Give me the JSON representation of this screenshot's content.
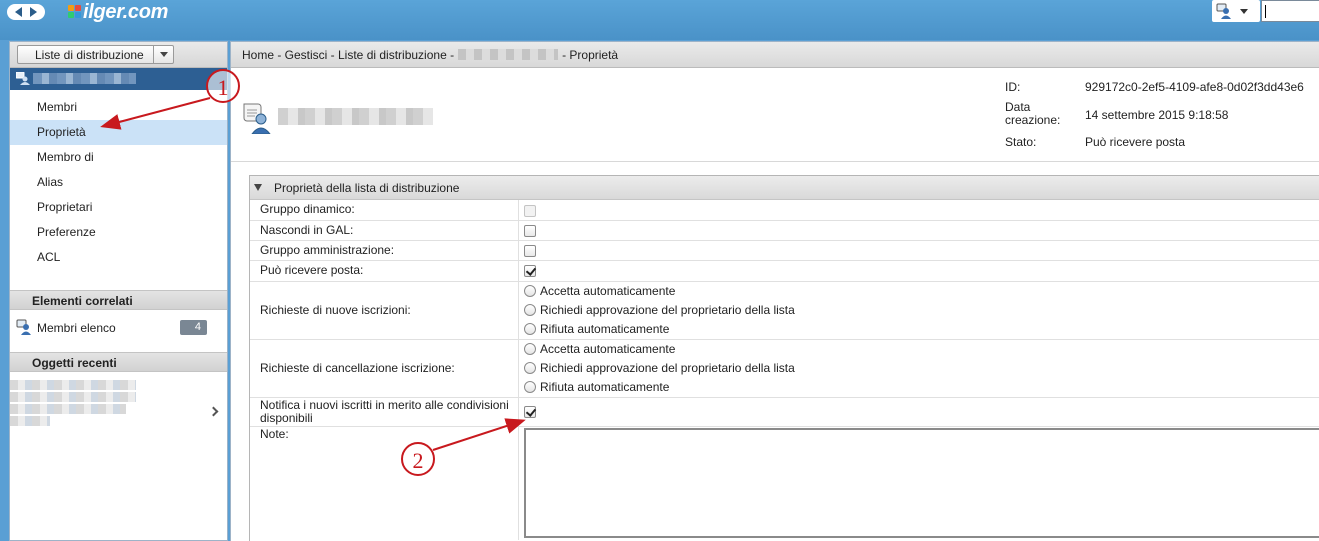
{
  "app": {
    "brand": "ilger.com"
  },
  "sidebar": {
    "back_button_label": "Liste di distribuzione",
    "nav_items": [
      {
        "label": "Membri",
        "active": false
      },
      {
        "label": "Proprietà",
        "active": true
      },
      {
        "label": "Membro di",
        "active": false
      },
      {
        "label": "Alias",
        "active": false
      },
      {
        "label": "Proprietari",
        "active": false
      },
      {
        "label": "Preferenze",
        "active": false
      },
      {
        "label": "ACL",
        "active": false
      }
    ],
    "related_section_title": "Elementi correlati",
    "related_items": [
      {
        "label": "Membri elenco",
        "count": "4"
      }
    ],
    "recent_section_title": "Oggetti recenti"
  },
  "breadcrumb": {
    "prefix": "Home - Gestisci - Liste di distribuzione -",
    "suffix": "- Proprietà"
  },
  "entity": {
    "meta": [
      {
        "label": "ID:",
        "value": "929172c0-2ef5-4109-afe8-0d02f3dd43e6"
      },
      {
        "label": "Data creazione:",
        "value": "14 settembre 2015 9:18:58"
      },
      {
        "label": "Stato:",
        "value": "Può ricevere posta"
      }
    ]
  },
  "properties": {
    "section_title": "Proprietà della lista di distribuzione",
    "checkbox_rows": [
      {
        "label": "Gruppo dinamico:",
        "checked": false,
        "disabled": true
      },
      {
        "label": "Nascondi in GAL:",
        "checked": false,
        "disabled": false
      },
      {
        "label": "Gruppo amministrazione:",
        "checked": false,
        "disabled": false
      },
      {
        "label": "Può ricevere posta:",
        "checked": true,
        "disabled": false
      }
    ],
    "subscription_requests": {
      "label": "Richieste di nuove iscrizioni:",
      "options": [
        "Accetta automaticamente",
        "Richiedi approvazione del proprietario della lista",
        "Rifiuta automaticamente"
      ]
    },
    "unsubscription_requests": {
      "label": "Richieste di cancellazione iscrizione:",
      "options": [
        "Accetta automaticamente",
        "Richiedi approvazione del proprietario della lista",
        "Rifiuta automaticamente"
      ]
    },
    "notify_row": {
      "label": "Notifica i nuovi iscritti in merito alle condivisioni disponibili",
      "checked": true
    },
    "notes_label": "Note:",
    "notes_value": ""
  },
  "annotations": [
    {
      "number": "1"
    },
    {
      "number": "2"
    }
  ],
  "colors": {
    "top_bar": "#4a92c8",
    "selected_entity": "#2d5f93",
    "active_nav": "#cbe2f7",
    "annotation": "#c8191e"
  }
}
